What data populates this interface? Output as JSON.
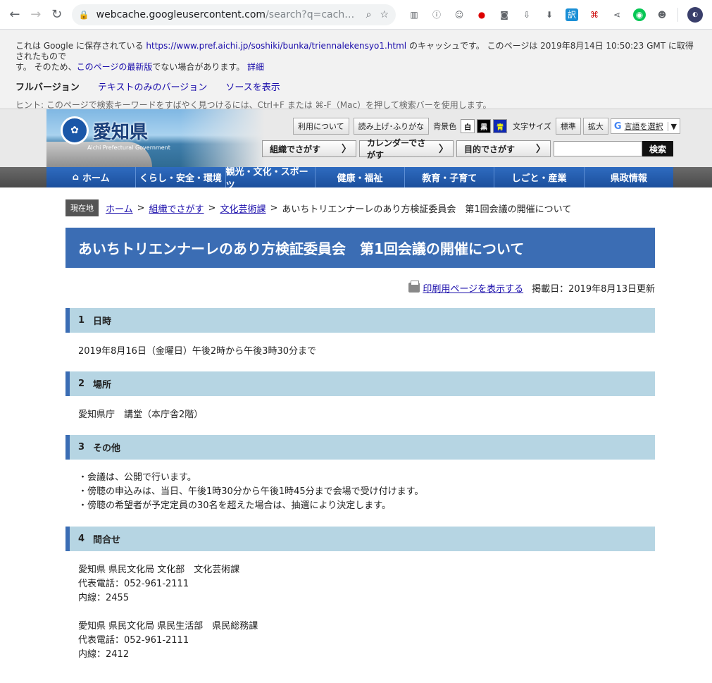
{
  "browser": {
    "url_host": "webcache.googleusercontent.com",
    "url_rest": "/search?q=cach…"
  },
  "cache_banner": {
    "line1_prefix": "これは Google に保存されている ",
    "source_url": "https://www.pref.aichi.jp/soshiki/bunka/triennalekensyo1.html",
    "line1_suffix": " のキャッシュです。 このページは 2019年8月14日 10:50:23 GMT に取得されたもので",
    "line2_prefix": "す。 そのため、",
    "latest_link": "このページの最新版",
    "line2_suffix": "でない場合があります。",
    "details_link": "詳細",
    "full_version": "フルバージョン",
    "text_only": "テキストのみのバージョン",
    "view_source": "ソースを表示",
    "hint": "ヒント: このページで検索キーワードをすばやく見つけるには、Ctrl+F または ⌘-F（Mac）を押して検索バーを使用します。"
  },
  "header": {
    "logo_name": "愛知県",
    "logo_en": "Aichi Prefectural Government",
    "about": "利用について",
    "reading": "読み上げ･ふりがな",
    "bg_label": "背景色",
    "bg_white": "白",
    "bg_black": "黒",
    "bg_blue": "青",
    "font_label": "文字サイズ",
    "font_normal": "標準",
    "font_large": "拡大",
    "lang_select": "言語を選択",
    "search_org": "組織でさがす",
    "search_calendar": "カレンダーでさがす",
    "search_purpose": "目的でさがす",
    "search_button": "検索"
  },
  "nav": [
    "ホーム",
    "くらし・安全・環境",
    "観光・文化・スポーツ",
    "健康・福祉",
    "教育・子育て",
    "しごと・産業",
    "県政情報"
  ],
  "breadcrumb": {
    "here": "現在地",
    "home": "ホーム",
    "org": "組織でさがす",
    "dept": "文化芸術課",
    "current": "あいちトリエンナーレのあり方検証委員会　第1回会議の開催について"
  },
  "page": {
    "title": "あいちトリエンナーレのあり方検証委員会　第1回会議の開催について",
    "print_link": "印刷用ページを表示する",
    "published": "掲載日：2019年8月13日更新",
    "sections": [
      {
        "num": "1",
        "heading": "日時",
        "lines": [
          "2019年8月16日（金曜日）午後2時から午後3時30分まで"
        ]
      },
      {
        "num": "2",
        "heading": "場所",
        "lines": [
          "愛知県庁　講堂（本庁舎2階）"
        ]
      },
      {
        "num": "3",
        "heading": "その他",
        "lines": [
          "・会議は、公開で行います。",
          "・傍聴の申込みは、当日、午後1時30分から午後1時45分まで会場で受け付けます。",
          "・傍聴の希望者が予定定員の30名を超えた場合は、抽選により決定します。"
        ]
      },
      {
        "num": "4",
        "heading": "問合せ",
        "lines": [
          "愛知県 県民文化局 文化部　文化芸術課",
          "代表電話：052-961-2111",
          "内線：2455",
          "",
          "愛知県 県民文化局 県民生活部　県民総務課",
          "代表電話：052-961-2111",
          "内線：2412"
        ]
      }
    ]
  }
}
